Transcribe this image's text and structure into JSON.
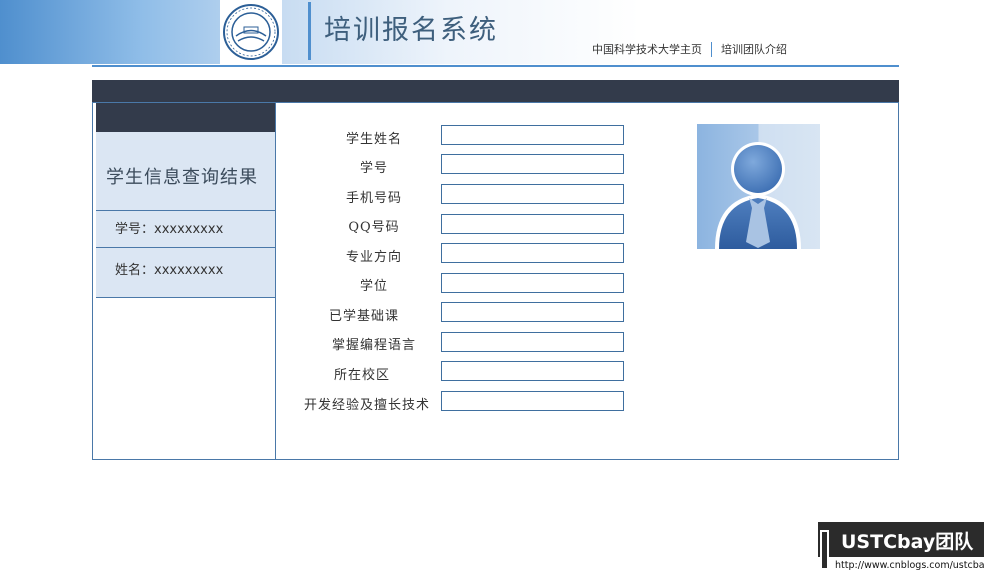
{
  "header": {
    "app_title": "培训报名系统",
    "nav": [
      "中国科学技术大学主页",
      "培训团队介绍"
    ]
  },
  "sidebar": {
    "title": "学生信息查询结果",
    "rows": [
      {
        "label": "学号：",
        "value": "xxxxxxxxx"
      },
      {
        "label": "姓名：",
        "value": "xxxxxxxxx"
      }
    ]
  },
  "form": {
    "fields": [
      {
        "label": "学生姓名",
        "value": ""
      },
      {
        "label": "学号",
        "value": ""
      },
      {
        "label": "手机号码",
        "value": ""
      },
      {
        "label": "QQ号码",
        "value": ""
      },
      {
        "label": "专业方向",
        "value": ""
      },
      {
        "label": "学位",
        "value": ""
      },
      {
        "label": "已学基础课",
        "value": ""
      },
      {
        "label": "掌握编程语言",
        "value": ""
      },
      {
        "label": "所在校区",
        "value": ""
      },
      {
        "label": "开发经验及擅长技术",
        "value": ""
      }
    ]
  },
  "footer": {
    "brand": "USTCbay团队",
    "url": "http://www.cnblogs.com/ustcbay/"
  },
  "colors": {
    "accent": "#4f8fce",
    "dark_bar": "#333b4b",
    "sidebar_bg": "#dbe6f3",
    "border": "#4a78a8"
  },
  "icons": [
    "university-seal-logo",
    "user-avatar-icon"
  ]
}
